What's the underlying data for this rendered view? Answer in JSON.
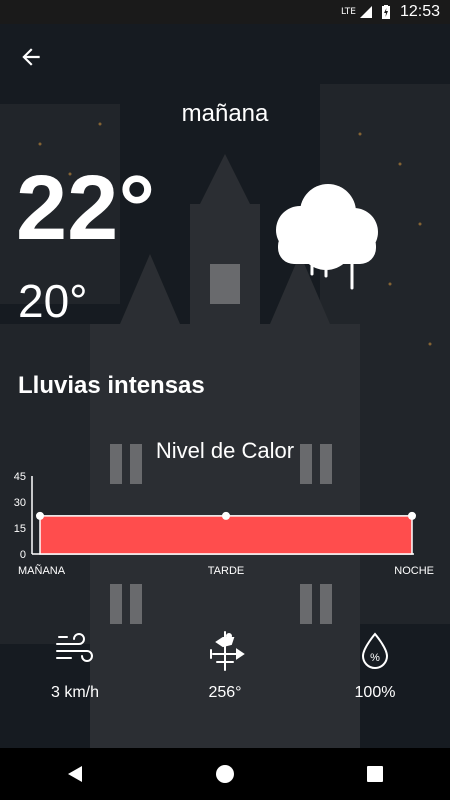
{
  "status_bar": {
    "network": "LTE",
    "time": "12:53"
  },
  "header": {
    "day": "mañana"
  },
  "weather": {
    "temp_max": "22°",
    "temp_min": "20°",
    "condition": "Lluvias intensas",
    "icon": "cloud-rain-icon"
  },
  "chart": {
    "title": "Nivel de Calor"
  },
  "chart_data": {
    "type": "area",
    "title": "Nivel de Calor",
    "categories": [
      "MAÑANA",
      "TARDE",
      "NOCHE"
    ],
    "values": [
      22,
      22,
      22
    ],
    "ylim": [
      0,
      45
    ],
    "yticks": [
      "45",
      "30",
      "15",
      "0"
    ],
    "color": "#ff4d4d"
  },
  "metrics": [
    {
      "icon": "wind-icon",
      "value": "3 km/h"
    },
    {
      "icon": "weathervane-icon",
      "value": "256°"
    },
    {
      "icon": "humidity-icon",
      "value": "100%"
    }
  ],
  "colors": {
    "accent": "#ff4d4d",
    "text": "#ffffff"
  }
}
